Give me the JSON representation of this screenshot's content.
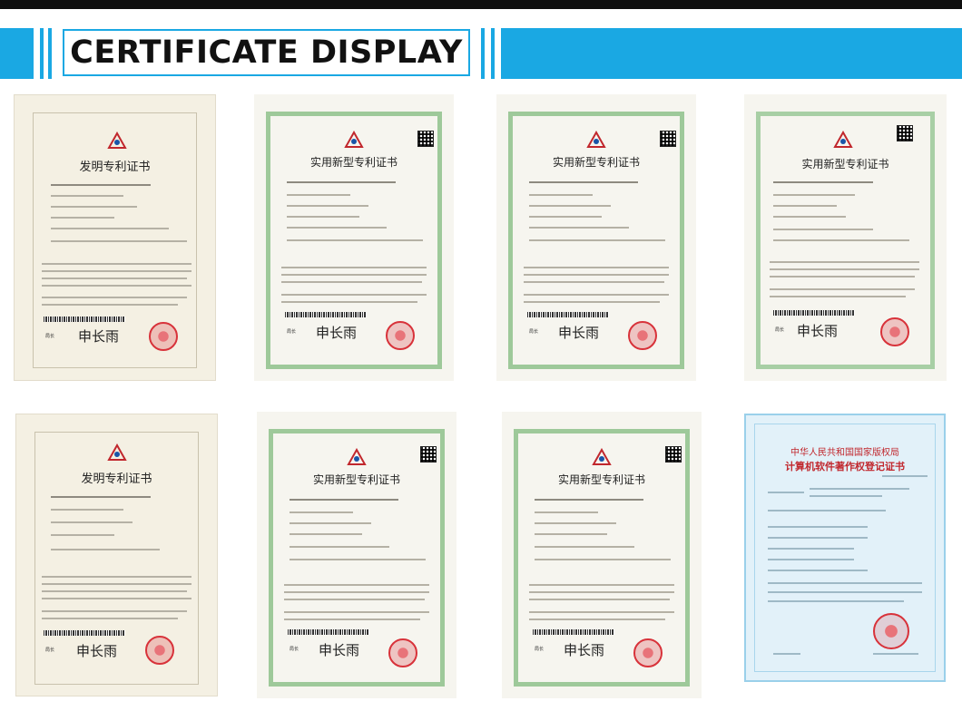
{
  "header": {
    "title": "CERTIFICATE DISPLAY"
  },
  "colors": {
    "accent": "#1aa8e3",
    "top_bar": "#0e0e0e",
    "seal_red": "#d8323a",
    "certificate_border_green": "#9ec99a"
  },
  "certificates": [
    {
      "kind": "invention-patent",
      "title": "发明专利证书",
      "signature": "申长雨",
      "sign_label": "局长"
    },
    {
      "kind": "utility-model-patent",
      "title": "实用新型专利证书",
      "signature": "申长雨",
      "sign_label": "局长"
    },
    {
      "kind": "utility-model-patent",
      "title": "实用新型专利证书",
      "signature": "申长雨",
      "sign_label": "局长"
    },
    {
      "kind": "utility-model-patent",
      "title": "实用新型专利证书",
      "signature": "申长雨",
      "sign_label": "局长"
    },
    {
      "kind": "invention-patent",
      "title": "发明专利证书",
      "signature": "申长雨",
      "sign_label": "局长"
    },
    {
      "kind": "utility-model-patent",
      "title": "实用新型专利证书",
      "signature": "申长雨",
      "sign_label": "局长"
    },
    {
      "kind": "utility-model-patent",
      "title": "实用新型专利证书",
      "signature": "申长雨",
      "sign_label": "局长"
    },
    {
      "kind": "software-copyright",
      "title_line1": "中华人民共和国国家版权局",
      "title_line2": "计算机软件著作权登记证书"
    }
  ]
}
